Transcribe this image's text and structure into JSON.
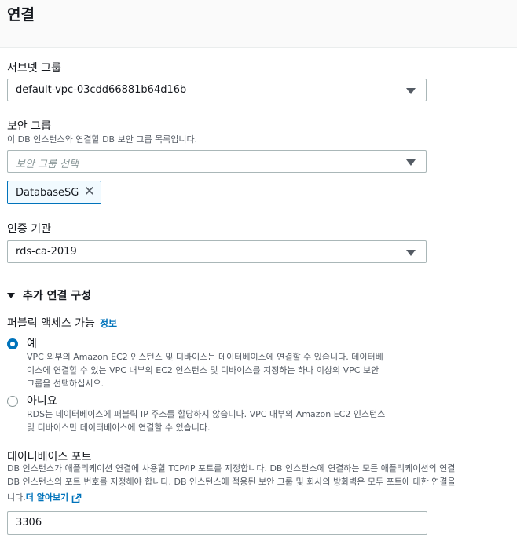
{
  "header": {
    "title": "연결"
  },
  "subnet_group": {
    "label": "서브넷 그룹",
    "value": "default-vpc-03cdd66881b64d16b"
  },
  "security_group": {
    "label": "보안 그룹",
    "description": "이 DB 인스턴스와 연결할 DB 보안 그룹 목록입니다.",
    "placeholder": "보안 그룹 선택",
    "tokens": [
      "DatabaseSG"
    ]
  },
  "certificate_authority": {
    "label": "인증 기관",
    "value": "rds-ca-2019"
  },
  "additional": {
    "title": "추가 연결 구성",
    "public_access": {
      "label": "퍼블릭 액세스 가능",
      "info": "정보",
      "options": [
        {
          "label": "예",
          "checked": true,
          "desc_lines": [
            "VPC 외부의 Amazon EC2 인스턴스 및 디바이스는 데이터베이스에 연결할 수 있습니다. 데이터베",
            "이스에 연결할 수 있는 VPC 내부의 EC2 인스턴스 및 디바이스를 지정하는 하나 이상의 VPC 보안",
            "그룹을 선택하십시오."
          ]
        },
        {
          "label": "아니요",
          "checked": false,
          "desc_lines": [
            "RDS는 데이터베이스에 퍼블릭 IP 주소를 할당하지 않습니다. VPC 내부의 Amazon EC2 인스턴스",
            "및 디바이스만 데이터베이스에 연결할 수 있습니다."
          ]
        }
      ]
    },
    "port": {
      "label": "데이터베이스 포트",
      "desc_lines": [
        "DB 인스턴스가 애플리케이션 연결에 사용할 TCP/IP 포트를 지정합니다. DB 인스턴스에 연결하는 모든 애플리케이션의 연결",
        "DB 인스턴스의 포트 번호를 지정해야 합니다. DB 인스턴스에 적용된 보안 그룹 및 회사의 방화벽은 모두 포트에 대한 연결을",
        "니다."
      ],
      "learn_more": "더 알아보기",
      "value": "3306"
    }
  }
}
